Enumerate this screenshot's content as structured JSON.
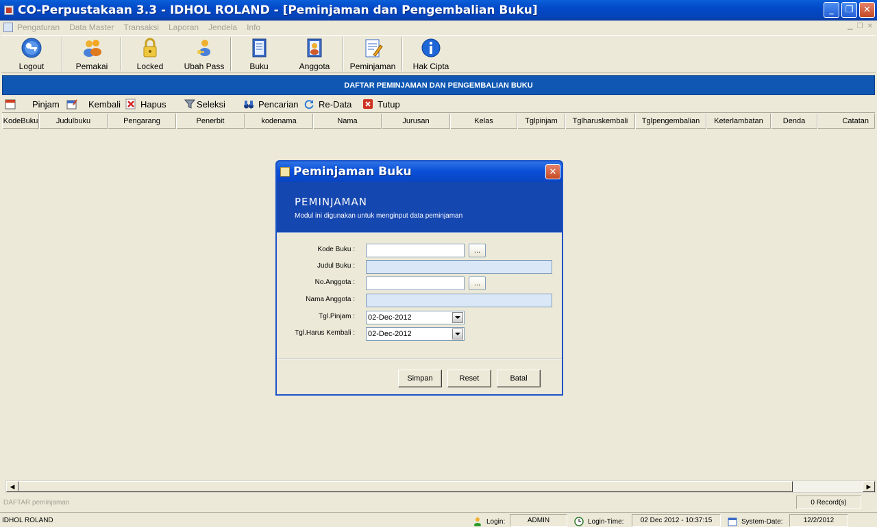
{
  "window": {
    "title": "CO-Perpustakaan 3.3 - IDHOL ROLAND - [Peminjaman dan Pengembalian Buku]",
    "minimize_label": "_",
    "restore_label": "❐",
    "close_label": "✕"
  },
  "menu": [
    "Pengaturan",
    "Data Master",
    "Transaksi",
    "Laporan",
    "Jendela",
    "Info"
  ],
  "toolbar": [
    "Logout",
    "Pemakai",
    "Locked",
    "Ubah Pass",
    "Buku",
    "Anggota",
    "Peminjaman",
    "Hak Cipta"
  ],
  "header": {
    "title": "DAFTAR PEMINJAMAN DAN PENGEMBALIAN BUKU"
  },
  "actions": [
    "Pinjam",
    "Kembali",
    "Hapus",
    "Seleksi",
    "Pencarian",
    "Re-Data",
    "Tutup"
  ],
  "columns": [
    "KodeBuku",
    "Judulbuku",
    "Pengarang",
    "Penerbit",
    "kodenama",
    "Nama",
    "Jurusan",
    "Kelas",
    "Tglpinjam",
    "Tglharuskembali",
    "Tglpengembalian",
    "Keterlambatan",
    "Denda",
    "Catatan"
  ],
  "status": {
    "left_text": "DAFTAR peminjaman",
    "records": "0 Record(s)",
    "user": "IDHOL ROLAND",
    "login_label": "Login:",
    "login_value": "ADMIN",
    "login_time_label": "Login-Time:",
    "login_time_value": "02 Dec 2012 - 10:37:15",
    "system_date_label": "System-Date:",
    "system_date_value": "12/2/2012"
  },
  "dialog": {
    "title": "Peminjaman Buku",
    "banner_title": "PEMINJAMAN",
    "banner_subtitle": "Modul ini digunakan untuk menginput data peminjaman",
    "fields": {
      "kode_buku_label": "Kode Buku :",
      "kode_buku_value": "",
      "judul_buku_label": "Judul Buku :",
      "judul_buku_value": "",
      "no_anggota_label": "No.Anggota :",
      "no_anggota_value": "",
      "nama_anggota_label": "Nama Anggota :",
      "nama_anggota_value": "",
      "tgl_pinjam_label": "Tgl.Pinjam :",
      "tgl_pinjam_value": "02-Dec-2012",
      "tgl_kembali_label": "Tgl.Harus Kembali :",
      "tgl_kembali_value": "02-Dec-2012"
    },
    "browse_label": "...",
    "buttons": {
      "save": "Simpan",
      "reset": "Reset",
      "cancel": "Batal"
    }
  },
  "colors": {
    "title_blue": "#0349c8",
    "header_blue": "#0f57b3",
    "face": "#ece9d8",
    "readonly_field": "#d9e7f7"
  }
}
